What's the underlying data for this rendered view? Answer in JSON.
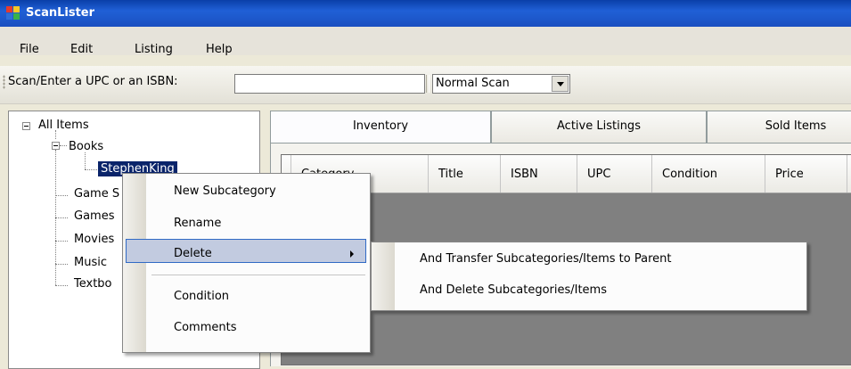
{
  "app": {
    "title": "ScanLister",
    "icon": "app-window-icon"
  },
  "menu": {
    "items": [
      "File",
      "Edit",
      "Listing",
      "Help"
    ]
  },
  "toolbar": {
    "scan_label": "Scan/Enter a UPC or an ISBN:",
    "scan_value": "",
    "mode_selected": "Normal Scan"
  },
  "tree": {
    "root": "All Items",
    "books": "Books",
    "selected": "StephenKing",
    "children": [
      "Game S",
      "Games",
      "Movies",
      "Music",
      "Textbo"
    ]
  },
  "tabs": [
    "Inventory",
    "Active Listings",
    "Sold Items"
  ],
  "grid": {
    "columns": [
      "Category",
      "Title",
      "ISBN",
      "UPC",
      "Condition",
      "Price"
    ]
  },
  "context_menu": {
    "items": [
      "New Subcategory",
      "Rename",
      "Delete",
      "Condition",
      "Comments"
    ],
    "highlighted": "Delete"
  },
  "submenu": {
    "items": [
      "And Transfer Subcategories/Items to Parent",
      "And Delete Subcategories/Items"
    ]
  },
  "colors": {
    "titlebar": "#0a3fa8",
    "selection": "#0a246a",
    "highlight": "#c2cbe0",
    "grid_bg": "#808080"
  }
}
